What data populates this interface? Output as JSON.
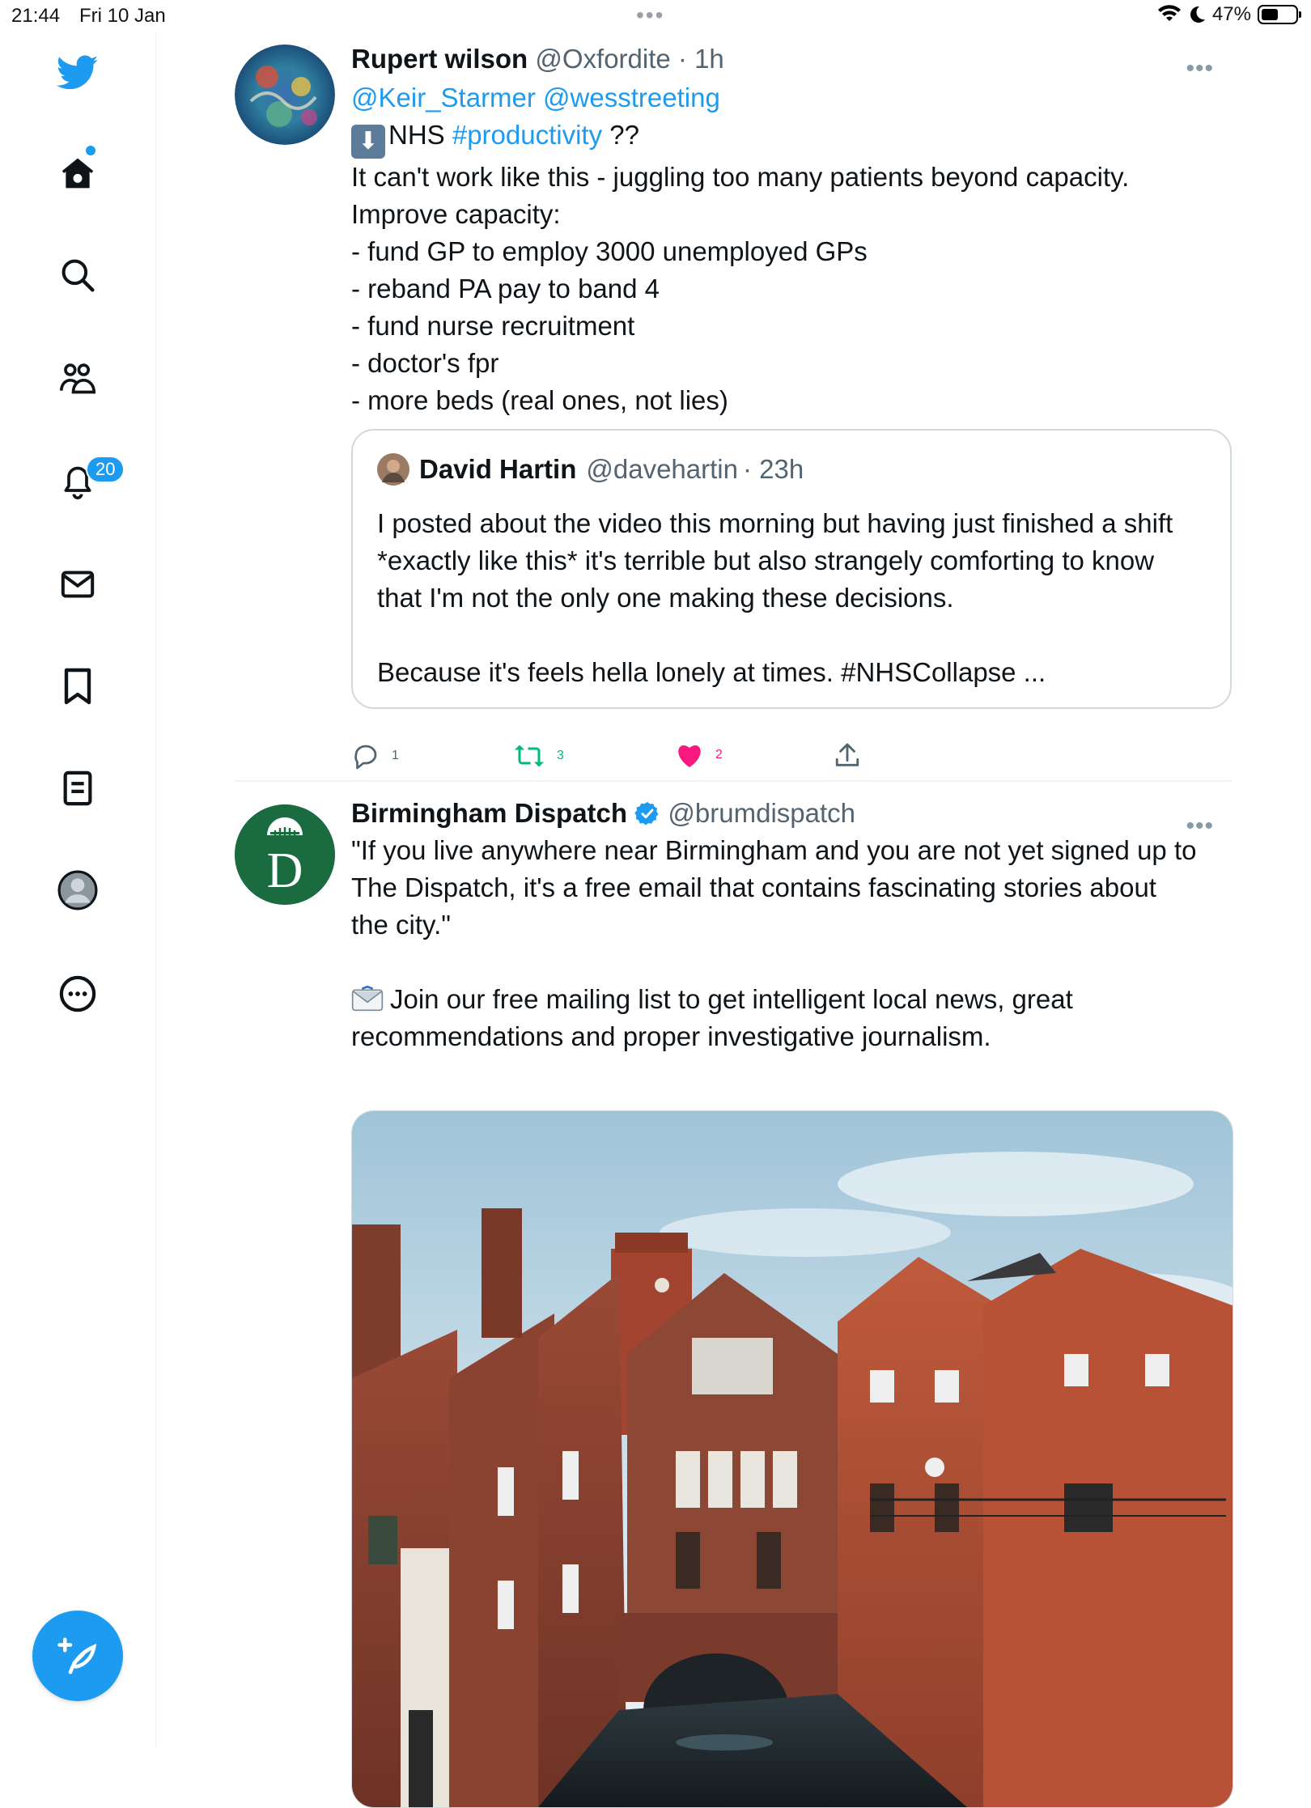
{
  "status_bar": {
    "time": "21:44",
    "date": "Fri 10 Jan",
    "battery": "47%",
    "icons": [
      "wifi-icon",
      "moon-icon",
      "battery-icon"
    ]
  },
  "sidebar": {
    "items": [
      {
        "name": "twitter-logo",
        "icon": "bird-icon"
      },
      {
        "name": "home",
        "icon": "home-icon"
      },
      {
        "name": "explore",
        "icon": "search-icon"
      },
      {
        "name": "communities",
        "icon": "people-icon"
      },
      {
        "name": "notifications",
        "icon": "bell-icon",
        "badge": "20"
      },
      {
        "name": "messages",
        "icon": "mail-icon"
      },
      {
        "name": "bookmarks",
        "icon": "bookmark-icon"
      },
      {
        "name": "lists",
        "icon": "list-icon"
      },
      {
        "name": "profile",
        "icon": "profile-icon"
      },
      {
        "name": "more",
        "icon": "more-circle-icon"
      }
    ],
    "compose_icon": "compose-tweet-icon"
  },
  "tweets": [
    {
      "name": "Rupert wilson",
      "handle": "@Oxfordite",
      "time": "· 1h",
      "mentions": "@Keir_Starmer @wesstreeting",
      "line2_text": "NHS ",
      "line2_hashtag": "#productivity",
      "line2_end": " ??",
      "body_lines": [
        "It can't work like this - juggling too many patients beyond capacity.",
        "Improve capacity:",
        "- fund GP to employ 3000 unemployed GPs",
        "- reband PA pay to band 4",
        "- fund nurse recruitment",
        "- doctor's fpr",
        "- more beds (real ones, not lies)"
      ],
      "quote": {
        "name": "David Hartin",
        "handle": "@davehartin",
        "time": "· 23h",
        "lines": [
          "I posted about the video this morning but having just finished a shift",
          "*exactly like this* it's terrible but also strangely comforting to know",
          "that I'm not the only one making these decisions.",
          "",
          "Because it's feels hella lonely at times. #NHSCollapse ..."
        ]
      },
      "replies": "1",
      "retweets": "3",
      "likes": "2",
      "colors": {
        "retweet": "#00ba7c",
        "like": "#f91880"
      }
    },
    {
      "name": "Birmingham Dispatch",
      "handle": "@brumdispatch",
      "verified": true,
      "avatar_color": "#1a6b3f",
      "avatar_letter": "D",
      "lines": [
        "\"If you live anywhere near Birmingham and you are not yet signed up to",
        "The Dispatch, it's a free email that contains fascinating stories about",
        "the city.\"",
        "",
        "Join our free mailing list to get intelligent local news, great",
        "recommendations and proper investigative journalism."
      ]
    }
  ],
  "accent": "#1d9bf0"
}
